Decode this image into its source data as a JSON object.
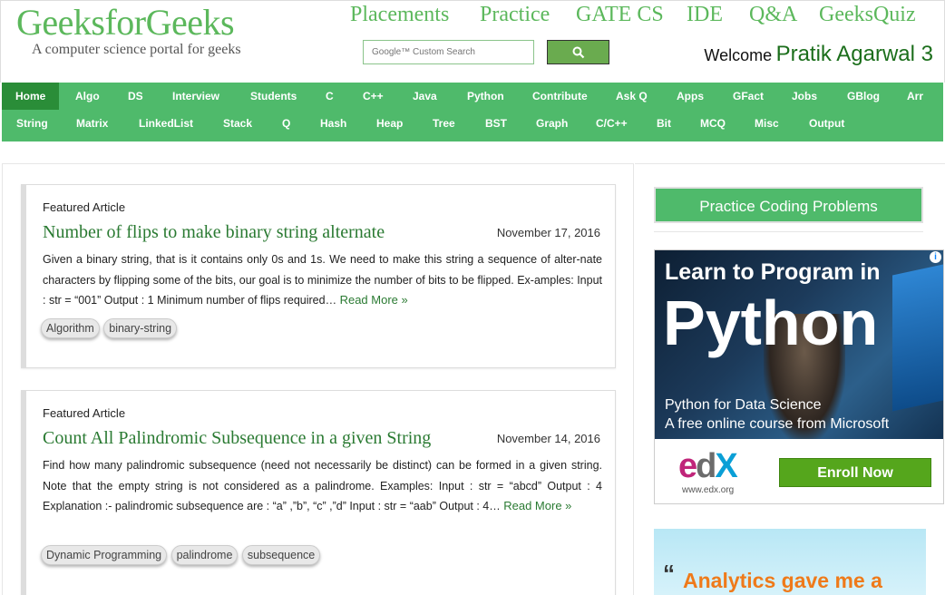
{
  "header": {
    "logo": "GeeksforGeeks",
    "tagline": "A computer science portal for geeks",
    "topnav": [
      "Placements",
      "Practice",
      "GATE CS",
      "IDE",
      "Q&A",
      "GeeksQuiz"
    ],
    "search_placeholder": "Google™ Custom Search",
    "welcome_label": "Welcome",
    "user_name": "Pratik Agarwal 3"
  },
  "nav": {
    "row1": [
      "Home",
      "Algo",
      "DS",
      "Interview",
      "Students",
      "C",
      "C++",
      "Java",
      "Python",
      "Contribute",
      "Ask Q",
      "Apps",
      "GFact",
      "Jobs",
      "GBlog",
      "Arr"
    ],
    "row2": [
      "String",
      "Matrix",
      "LinkedList",
      "Stack",
      "Q",
      "Hash",
      "Heap",
      "Tree",
      "BST",
      "Graph",
      "C/C++",
      "Bit",
      "MCQ",
      "Misc",
      "Output"
    ]
  },
  "articles": [
    {
      "caption": "Featured Article",
      "title": "Number of flips to make binary string alternate",
      "date": "November 17, 2016",
      "excerpt": "Given a binary string, that is it contains only 0s and 1s. We need to make this string a sequence of alter-nate characters by flipping some of the bits, our goal is to minimize the number of bits to be flipped. Ex-amples: Input : str = “001” Output : 1 Minimum number of flips required…",
      "read_more": "Read More »",
      "tags": [
        "Algorithm",
        "binary-string"
      ]
    },
    {
      "caption": "Featured Article",
      "title": "Count All Palindromic Subsequence in a given String",
      "date": "November 14, 2016",
      "excerpt": "Find how many palindromic subsequence (need not necessarily be distinct) can be formed in a given string. Note that the empty string is not considered as a palindrome. Examples: Input : str = “abcd” Output : 4 Explanation :- palindromic subsequence are : “a” ,”b”, “c” ,”d” Input : str = “aab” Output : 4…",
      "read_more": "Read More »",
      "tags": [
        "Dynamic Programming",
        "palindrome",
        "subsequence"
      ]
    }
  ],
  "sidebar": {
    "practice_button": "Practice Coding Problems",
    "ad": {
      "headline": "Learn to Program in",
      "big": "Python",
      "sub1": "Python for Data Science",
      "sub2": "A free online course from Microsoft",
      "brand": "edX",
      "brand_url": "www.edx.org",
      "cta": "Enroll Now",
      "info_icon": "info-icon"
    },
    "ad2": {
      "quote_mark": "“",
      "text": "Analytics gave me a"
    }
  },
  "colors": {
    "brand_green": "#4fba6b",
    "active_nav": "#2a8d38",
    "link_green": "#2a7a32",
    "enroll_green": "#55a61c"
  }
}
